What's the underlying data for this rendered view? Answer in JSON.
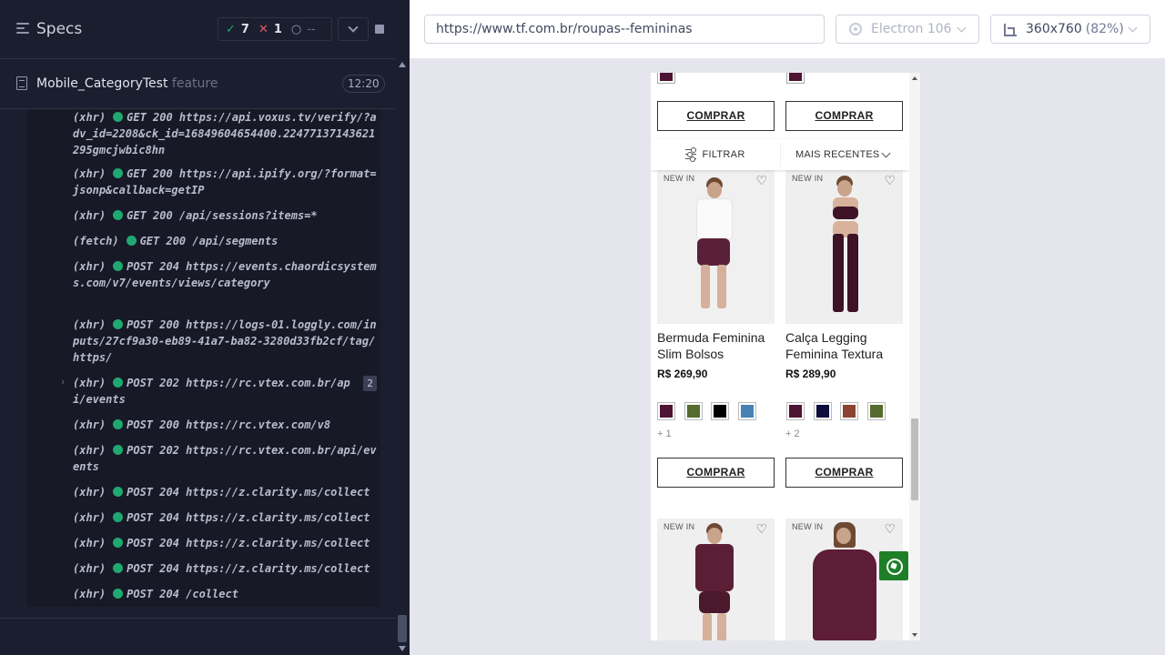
{
  "runner": {
    "title": "Specs",
    "stats": {
      "passed": "7",
      "failed": "1",
      "pending": "--"
    },
    "spec": {
      "name": "Mobile_CategoryTest",
      "ext": " feature",
      "time": "12:20"
    },
    "logs": [
      {
        "type": "(xhr)",
        "text": "GET 200 https://api.voxus.tv/verify/?adv_id=2208&ck_id=16849604654400.22477137143621295gmcjwbic8hn"
      },
      {
        "type": "(xhr)",
        "text": "GET 200 https://api.ipify.org/?format=jsonp&callback=getIP"
      },
      {
        "type": "(xhr)",
        "text": "GET 200 /api/sessions?items=*"
      },
      {
        "type": "(fetch)",
        "text": "GET 200 /api/segments"
      },
      {
        "type": "(xhr)",
        "text": "POST 204 https://events.chaordicsystems.com/v7/events/views/category"
      },
      {
        "type": "(xhr)",
        "text": "POST 200 https://logs-01.loggly.com/inputs/27cf9a30-eb89-41a7-ba82-3280d33fb2cf/tag/https/"
      },
      {
        "type": "(xhr)",
        "text": "POST 202 https://rc.vtex.com.br/api/events",
        "count": "2"
      },
      {
        "type": "(xhr)",
        "text": "POST 200 https://rc.vtex.com/v8"
      },
      {
        "type": "(xhr)",
        "text": "POST 202 https://rc.vtex.com.br/api/events"
      },
      {
        "type": "(xhr)",
        "text": "POST 204 https://z.clarity.ms/collect"
      },
      {
        "type": "(xhr)",
        "text": "POST 204 https://z.clarity.ms/collect"
      },
      {
        "type": "(xhr)",
        "text": "POST 204 https://z.clarity.ms/collect"
      },
      {
        "type": "(xhr)",
        "text": "POST 204 https://z.clarity.ms/collect"
      },
      {
        "type": "(xhr)",
        "text": "POST 204 /collect"
      }
    ]
  },
  "topbar": {
    "url": "https://www.tf.com.br/roupas--femininas",
    "browser": "Electron 106",
    "viewport": "360x760",
    "zoom": "(82%)"
  },
  "preview": {
    "buy_label": "COMPRAR",
    "filter_label": "FILTRAR",
    "sort_label": "MAIS RECENTES",
    "badge": "NEW IN",
    "products": [
      {
        "name": "Bermuda Feminina Slim Bolsos",
        "price": "R$ 269,90",
        "more": "+ 1",
        "swatches": [
          "#4e1433",
          "#556b2f",
          "#000000",
          "#4682b4"
        ]
      },
      {
        "name": "Calça Legging Feminina Textura",
        "price": "R$ 289,90",
        "more": "+ 2",
        "swatches": [
          "#4e1433",
          "#0d0c3c",
          "#8b4332",
          "#556b2f"
        ]
      }
    ],
    "top_swatch": "#4e1433"
  }
}
